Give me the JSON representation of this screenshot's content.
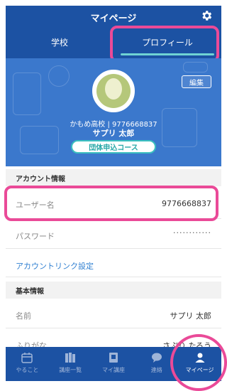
{
  "header": {
    "title": "マイページ",
    "settings_icon": "gear-icon"
  },
  "tabs": [
    {
      "label": "学校",
      "active": false
    },
    {
      "label": "プロフィール",
      "active": true
    }
  ],
  "profile": {
    "edit_label": "編集",
    "school_line": "かもめ高校 | 9776668837",
    "name": "サプリ 太郎",
    "course": "団体申込コース"
  },
  "account": {
    "section_title": "アカウント情報",
    "username_label": "ユーザー名",
    "username_value": "9776668837",
    "password_label": "パスワード",
    "password_value": "············",
    "link_settings": "アカウントリンク設定"
  },
  "basic": {
    "section_title": "基本情報",
    "name_label": "名前",
    "name_value": "サプリ 太郎",
    "furigana_label": "ふりがな",
    "furigana_value": "さぷり たろう"
  },
  "bottom_nav": [
    {
      "label": "やること",
      "icon": "calendar-icon",
      "active": false
    },
    {
      "label": "講座一覧",
      "icon": "books-icon",
      "active": false
    },
    {
      "label": "マイ講座",
      "icon": "notebook-icon",
      "active": false
    },
    {
      "label": "連絡",
      "icon": "chat-icon",
      "active": false
    },
    {
      "label": "マイページ",
      "icon": "person-icon",
      "active": true
    }
  ],
  "colors": {
    "primary": "#1c52a3",
    "banner": "#3b78cc",
    "accent": "#3bbfbf",
    "highlight": "#ea4a98",
    "link": "#2f7fd1"
  }
}
